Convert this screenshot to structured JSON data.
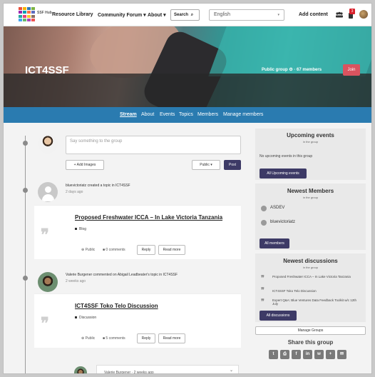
{
  "topnav": {
    "logo_text": "SSF Hub",
    "links": [
      "Resource Library",
      "Community Forum ▾",
      "About ▾"
    ],
    "search_label": "Search",
    "language": "English",
    "add_content": "Add content",
    "notification_count": "3",
    "logo_colors": [
      "#e94e3c",
      "#f4b400",
      "#2e7bb3",
      "#7cb342",
      "#9c27b0",
      "#00a0b0",
      "#ff7043",
      "#5c6bc0",
      "#26a69a",
      "#ec407a",
      "#ffca28",
      "#8d6e63",
      "#42a5f5",
      "#66bb6a",
      "#ab47bc",
      "#ef5350"
    ]
  },
  "hero": {
    "title": "ICT4SSF",
    "meta": "Public group ⚙ · 67 members",
    "join_label": "Join"
  },
  "tabs": [
    "Stream",
    "About",
    "Events",
    "Topics",
    "Members",
    "Manage members"
  ],
  "composer": {
    "placeholder": "Say something to the group",
    "add_images": "+ Add Images",
    "visibility": "Public ▾",
    "post": "Post"
  },
  "stream": [
    {
      "activity": "bluevictoriatz created a topic in ICT4SSF",
      "time": "2 days ago",
      "title": "Proposed Freshwater ICCA – In Lake Victoria Tanzania",
      "tag": "Blog",
      "visibility": "Public",
      "comments": "0 comments",
      "reply": "Reply",
      "read_more": "Read more"
    },
    {
      "activity": "Valerie Burgener commented on Abigail Leadbeater's topic in ICT4SSF",
      "time": "2 weeks ago",
      "title": "ICT4SSF Toko Telo Discussion",
      "tag": "Discussion",
      "visibility": "Public",
      "comments": "5 comments",
      "reply": "Reply",
      "read_more": "Read more"
    }
  ],
  "comment_preview": "Valerie Burgener · 2 weeks ago",
  "sidebar": {
    "events": {
      "title": "Upcoming events",
      "sub": "in the group",
      "empty": "No upcoming events in this group",
      "button": "All Upcoming events"
    },
    "members": {
      "title": "Newest Members",
      "sub": "in the group",
      "items": [
        "ASDEV",
        "bluevictoriatz"
      ],
      "button": "All members"
    },
    "discussions": {
      "title": "Newest discussions",
      "sub": "in the group",
      "items": [
        "Proposed Freshwater ICCA – In Lake Victoria Tanzania",
        "ICT4SSF Toko Telo Discussion",
        "Expert Q&A: Blue Ventures Data Feedback Toolkit w/c 12th July"
      ],
      "button": "All discussions"
    },
    "manage_groups": "Manage Groups",
    "share_title": "Share this group",
    "share_icons": [
      "twitter-icon",
      "print-icon",
      "facebook-icon",
      "linkedin-icon",
      "whatsapp-icon",
      "plus-icon",
      "email-icon"
    ],
    "share_glyphs": [
      "t",
      "⎙",
      "f",
      "in",
      "w",
      "+",
      "✉"
    ]
  }
}
